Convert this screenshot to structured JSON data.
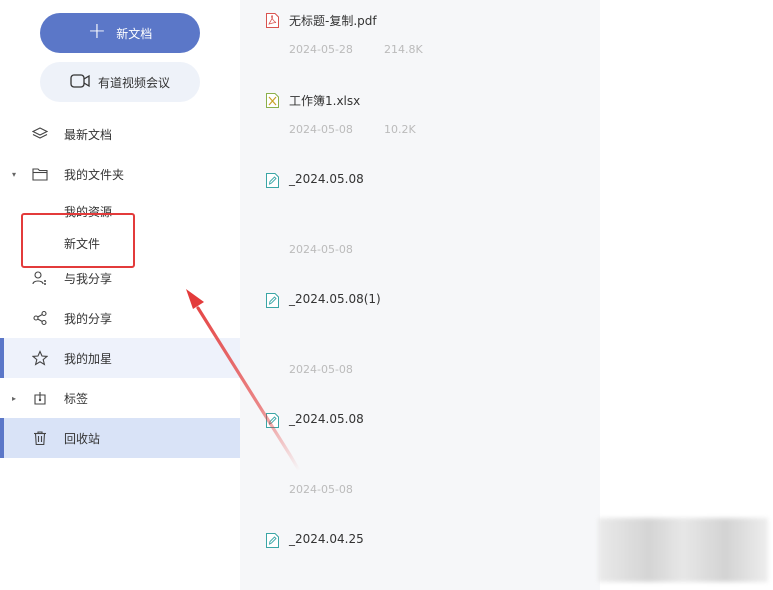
{
  "sidebar": {
    "new_doc_label": "新文档",
    "meeting_label": "有道视频会议",
    "items": [
      {
        "label": "最新文档"
      },
      {
        "label": "我的文件夹"
      },
      {
        "label": "我的资源"
      },
      {
        "label": "新文件"
      },
      {
        "label": "与我分享"
      },
      {
        "label": "我的分享"
      },
      {
        "label": "我的加星"
      },
      {
        "label": "标签"
      },
      {
        "label": "回收站"
      }
    ]
  },
  "files": [
    {
      "name": "无标题-复制.pdf",
      "date": "2024-05-28",
      "size": "214.8K",
      "icon": "pdf-icon"
    },
    {
      "name": "工作簿1.xlsx",
      "date": "2024-05-08",
      "size": "10.2K",
      "icon": "xlsx-icon"
    },
    {
      "name": "_2024.05.08",
      "date": "2024-05-08",
      "size": "",
      "icon": "note-icon"
    },
    {
      "name": "_2024.05.08(1)",
      "date": "2024-05-08",
      "size": "",
      "icon": "note-icon"
    },
    {
      "name": "_2024.05.08",
      "date": "2024-05-08",
      "size": "",
      "icon": "note-icon"
    },
    {
      "name": "_2024.04.25",
      "date": "",
      "size": "",
      "icon": "note-icon"
    }
  ],
  "colors": {
    "accent": "#5b77c8",
    "annotation": "#e33b3b"
  }
}
